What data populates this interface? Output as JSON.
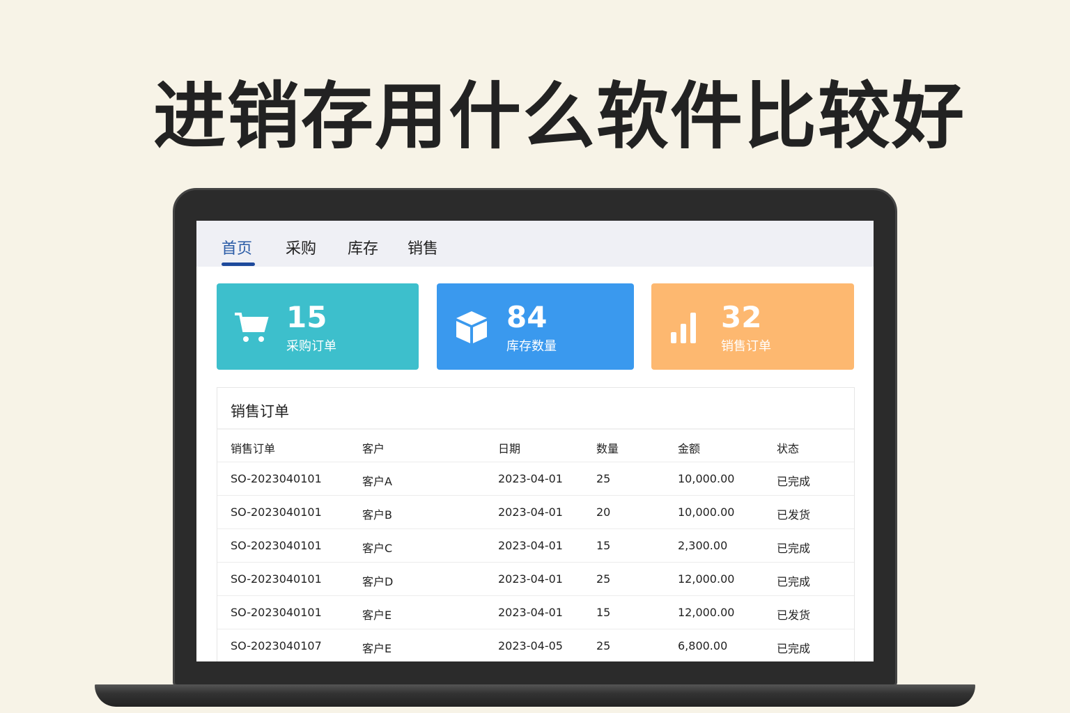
{
  "headline": "进销存用什么软件比较好",
  "tabs": [
    {
      "label": "首页",
      "active": true
    },
    {
      "label": "采购"
    },
    {
      "label": "库存"
    },
    {
      "label": "销售"
    }
  ],
  "cards": [
    {
      "value": "15",
      "label": "采购订单",
      "icon": "cart-icon",
      "color": "#3dbfcc"
    },
    {
      "value": "84",
      "label": "库存数量",
      "icon": "box-icon",
      "color": "#3a99ee"
    },
    {
      "value": "32",
      "label": "销售订单",
      "icon": "bar-chart-icon",
      "color": "#fdb870"
    }
  ],
  "table": {
    "title": "销售订单",
    "headers": [
      "销售订单",
      "客户",
      "日期",
      "数量",
      "金额",
      "状态"
    ],
    "rows": [
      [
        "SO-2023040101",
        "客户A",
        "2023-04-01",
        "25",
        "10,000.00",
        "已完成"
      ],
      [
        "SO-2023040101",
        "客户B",
        "2023-04-01",
        "20",
        "10,000.00",
        "已发货"
      ],
      [
        "SO-2023040101",
        "客户C",
        "2023-04-01",
        "15",
        "2,300.00",
        "已完成"
      ],
      [
        "SO-2023040101",
        "客户D",
        "2023-04-01",
        "25",
        "12,000.00",
        "已完成"
      ],
      [
        "SO-2023040101",
        "客户E",
        "2023-04-01",
        "15",
        "12,000.00",
        "已发货"
      ],
      [
        "SO-2023040107",
        "客户E",
        "2023-04-05",
        "25",
        "6,800.00",
        "已完成"
      ]
    ]
  }
}
